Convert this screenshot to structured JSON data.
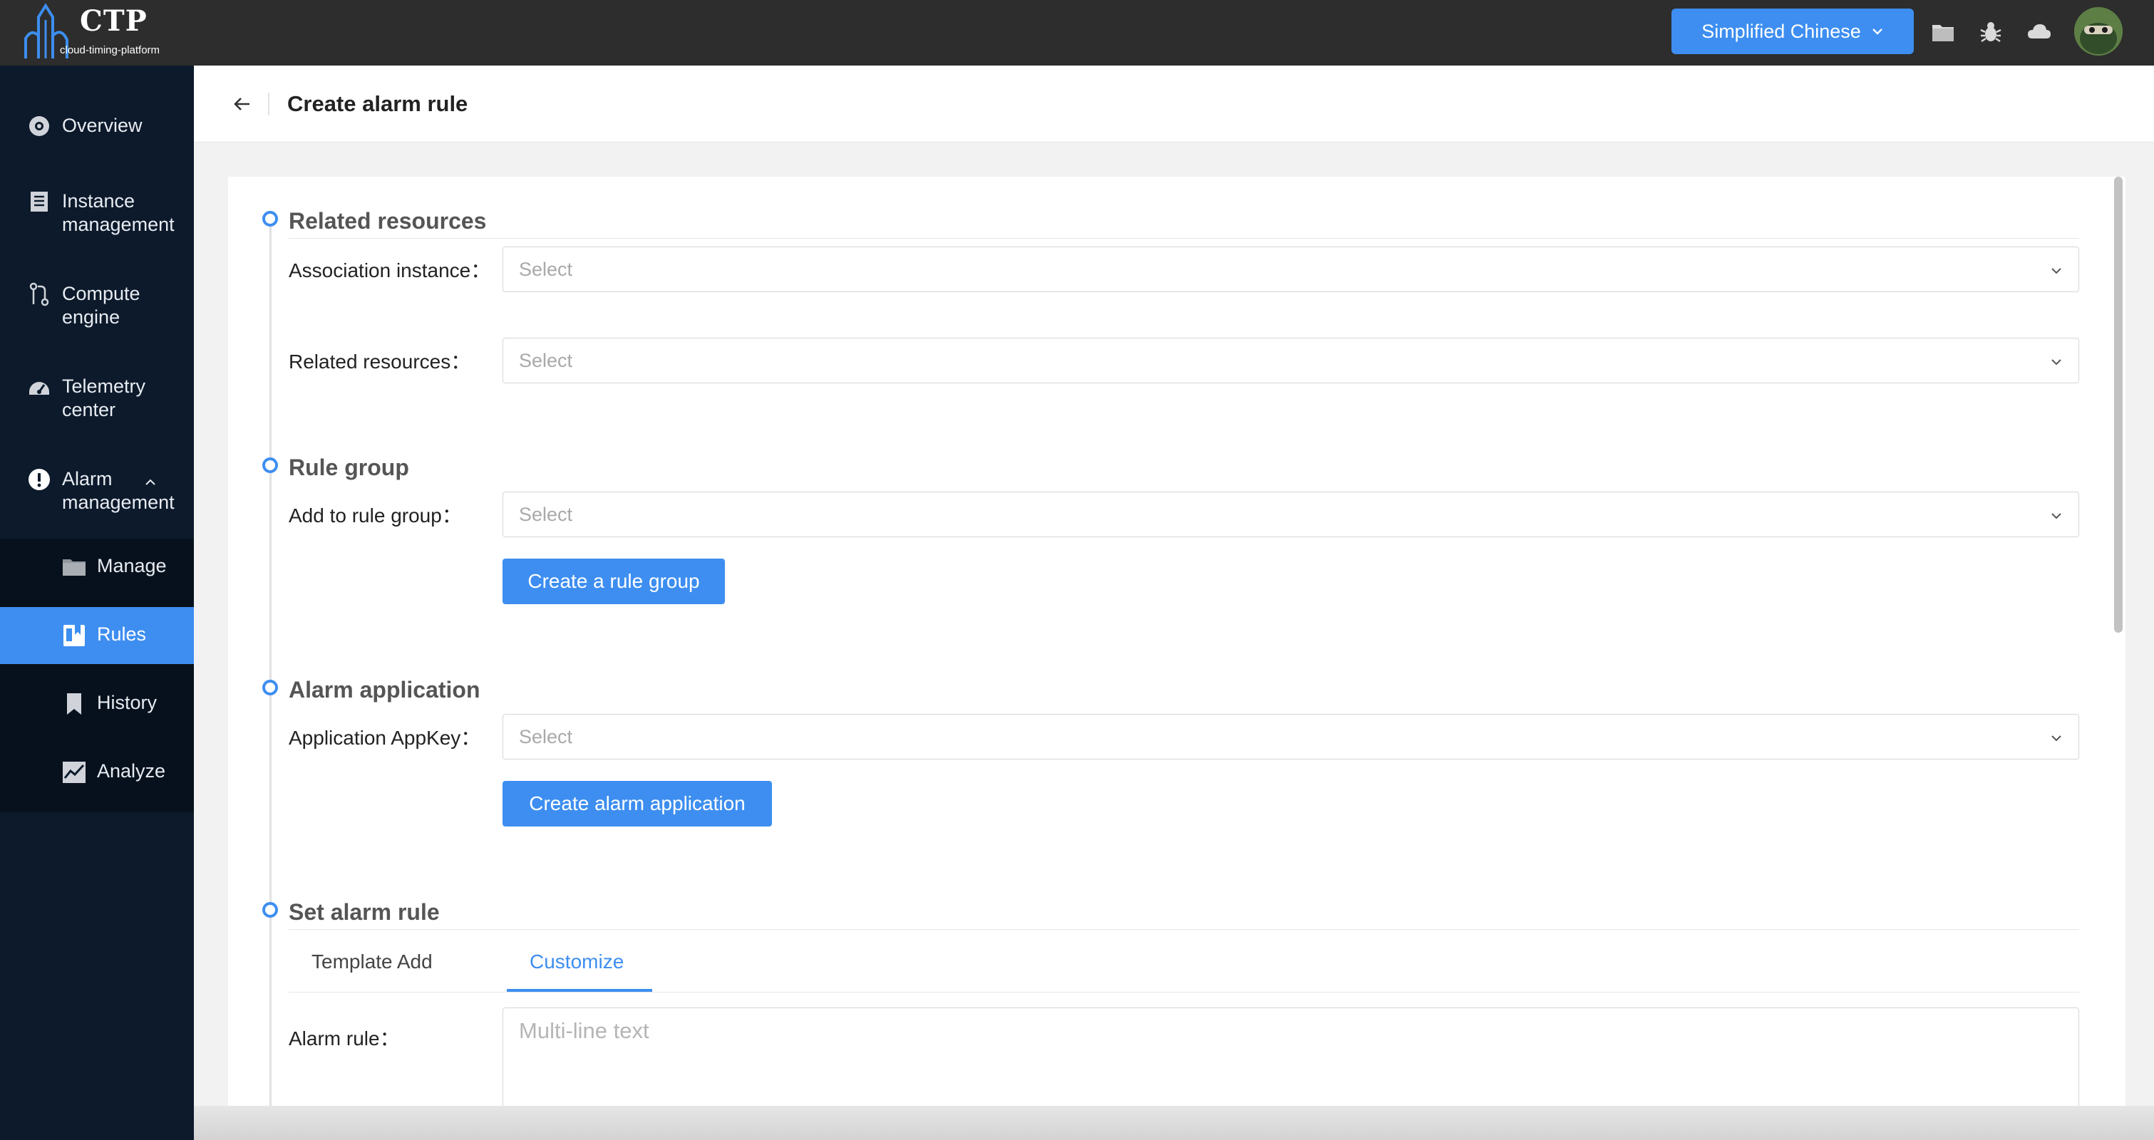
{
  "app": {
    "logo_title": "CTP",
    "logo_subtitle": "cloud-timing-platform"
  },
  "topbar": {
    "language_button": "Simplified Chinese",
    "icons": [
      "folder-icon",
      "bug-icon",
      "cloud-icon",
      "avatar"
    ]
  },
  "sidebar": {
    "items": [
      {
        "label": "Overview",
        "icon": "overview-icon"
      },
      {
        "label": "Instance management",
        "line1": "Instance",
        "line2": "management",
        "icon": "document-icon"
      },
      {
        "label": "Compute engine",
        "line1": "Compute",
        "line2": "engine",
        "icon": "compute-icon"
      },
      {
        "label": "Telemetry center",
        "line1": "Telemetry",
        "line2": "center",
        "icon": "telemetry-icon"
      },
      {
        "label": "Alarm management",
        "line1": "Alarm",
        "line2": "management",
        "icon": "alert-icon",
        "expanded": true
      }
    ],
    "submenu": [
      {
        "label": "Manage",
        "icon": "folder-icon",
        "active": false
      },
      {
        "label": "Rules",
        "icon": "rules-icon",
        "active": true
      },
      {
        "label": "History",
        "icon": "bookmark-icon",
        "active": false
      },
      {
        "label": "Analyze",
        "icon": "chart-icon",
        "active": false
      }
    ]
  },
  "header": {
    "title": "Create alarm rule"
  },
  "form": {
    "related_resources": {
      "title": "Related resources",
      "association_instance_label": "Association instance：",
      "association_instance_placeholder": "Select",
      "related_resources_label": "Related resources：",
      "related_resources_placeholder": "Select"
    },
    "rule_group": {
      "title": "Rule group",
      "add_label": "Add to rule group：",
      "add_placeholder": "Select",
      "create_button": "Create a rule group"
    },
    "alarm_application": {
      "title": "Alarm application",
      "appkey_label": "Application AppKey：",
      "appkey_placeholder": "Select",
      "create_button": "Create alarm application"
    },
    "set_alarm_rule": {
      "title": "Set alarm rule",
      "tabs": [
        {
          "label": "Template Add",
          "active": false
        },
        {
          "label": "Customize",
          "active": true
        }
      ],
      "alarm_rule_label": "Alarm rule：",
      "alarm_rule_placeholder": "Multi-line text"
    }
  },
  "colors": {
    "accent": "#3d8ef0",
    "sidebar_bg": "#0c1a2b",
    "topbar_bg": "#2d2d2d"
  }
}
